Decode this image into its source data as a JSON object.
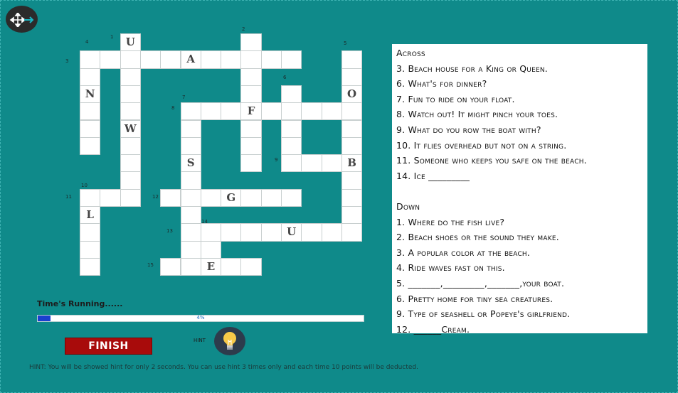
{
  "clues": {
    "across_header": "Across",
    "across": [
      "3. Beach house for a King or Queen.",
      "6. What's for dinner?",
      "7. Fun to ride on your float.",
      "8. Watch out! It might pinch your toes.",
      "9. What do you row the boat with?",
      "10. It flies overhead but not on a string.",
      "11. Someone who keeps you safe on the beach.",
      "14. Ice _________"
    ],
    "down_header": "Down",
    "down": [
      "1. Where do the fish live?",
      "2. Beach shoes or the sound they make.",
      "3. A popular color at the beach.",
      "4. Ride waves fast on this.",
      "5. _______,_________,_______,your boat.",
      "6. Pretty home for tiny sea creatures.",
      "9. Type of seashell or Popeye's girlfriend.",
      "12. ______Cream."
    ]
  },
  "puzzle": {
    "numbers": [
      "1",
      "2",
      "3",
      "4",
      "5",
      "6",
      "7",
      "8",
      "9",
      "10",
      "11",
      "12",
      "13",
      "14",
      "15"
    ],
    "revealed_letters": [
      "U",
      "A",
      "N",
      "O",
      "F",
      "W",
      "S",
      "B",
      "G",
      "L",
      "U",
      "E"
    ]
  },
  "timer": {
    "label": "Time's  Running......",
    "progress_percent": 4,
    "progress_text": "4%"
  },
  "buttons": {
    "finish_label": "FINISH",
    "hint_label": "HINT"
  },
  "hint_note": "HINT: You will be showed hint for only 2 seconds.     You can use hint 3 times only and each time 10 points will be deducted."
}
